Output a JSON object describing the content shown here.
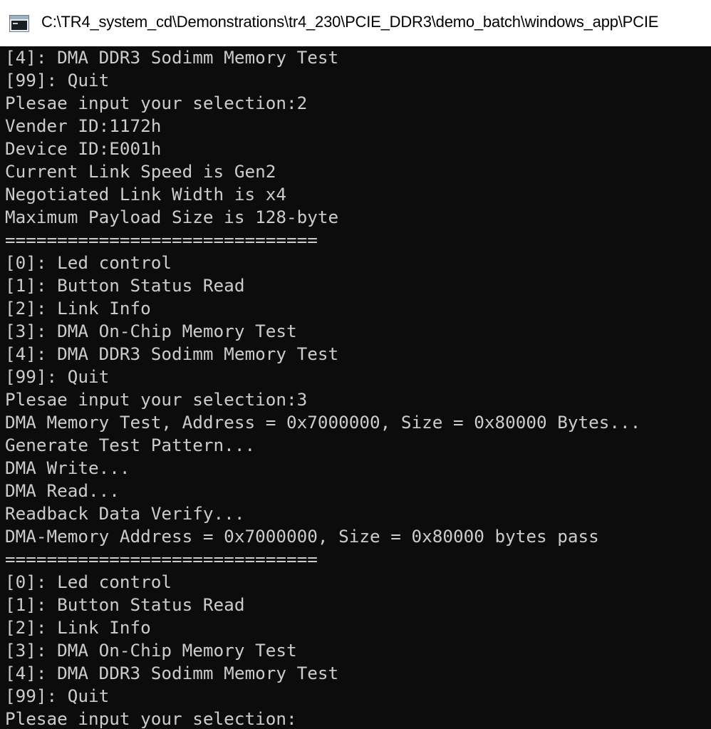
{
  "window": {
    "title": "C:\\TR4_system_cd\\Demonstrations\\tr4_230\\PCIE_DDR3\\demo_batch\\windows_app\\PCIE",
    "icon": "console-app-icon"
  },
  "console": {
    "lines": [
      "[4]: DMA DDR3 Sodimm Memory Test",
      "[99]: Quit",
      "Plesae input your selection:2",
      "Vender ID:1172h",
      "Device ID:E001h",
      "Current Link Speed is Gen2",
      "Negotiated Link Width is x4",
      "Maximum Payload Size is 128-byte",
      "==============================",
      "[0]: Led control",
      "[1]: Button Status Read",
      "[2]: Link Info",
      "[3]: DMA On-Chip Memory Test",
      "[4]: DMA DDR3 Sodimm Memory Test",
      "[99]: Quit",
      "Plesae input your selection:3",
      "DMA Memory Test, Address = 0x7000000, Size = 0x80000 Bytes...",
      "Generate Test Pattern...",
      "DMA Write...",
      "DMA Read...",
      "Readback Data Verify...",
      "DMA-Memory Address = 0x7000000, Size = 0x80000 bytes pass",
      "==============================",
      "[0]: Led control",
      "[1]: Button Status Read",
      "[2]: Link Info",
      "[3]: DMA On-Chip Memory Test",
      "[4]: DMA DDR3 Sodimm Memory Test",
      "[99]: Quit",
      "Plesae input your selection:"
    ]
  },
  "colors": {
    "console_background": "#0c0c0c",
    "console_text": "#cccccc",
    "titlebar_background": "#ffffff",
    "title_text": "#000000"
  }
}
